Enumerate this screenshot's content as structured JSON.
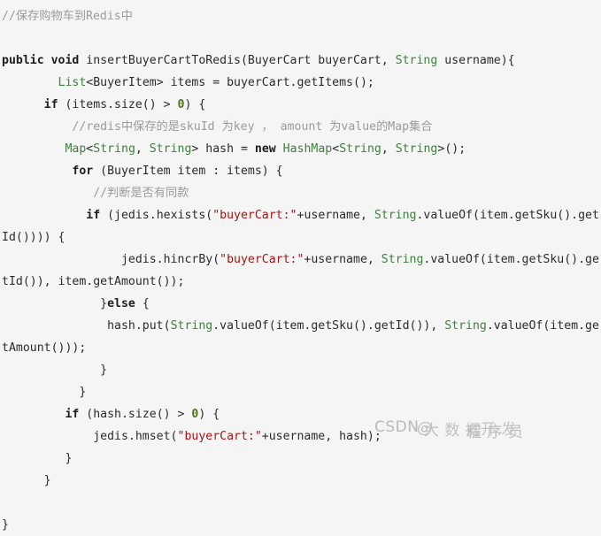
{
  "editor": {
    "language": "java",
    "background_color": "#f5f5f5",
    "default_text_color": "#2b2b2b",
    "colors": {
      "comment": "#9b9b9b",
      "keyword": "#1d1d1d",
      "type": "#3f7f3f",
      "string": "#a31515",
      "number": "#4f6f1f"
    }
  },
  "code": {
    "title_comment": "//保存购物车到Redis中",
    "lines": [
      {
        "id": "line-1",
        "tokens": [
          {
            "t": "comment",
            "v": "//保存购物车到Redis中"
          }
        ]
      },
      {
        "id": "line-2",
        "blank": true,
        "tokens": []
      },
      {
        "id": "line-3",
        "tokens": [
          {
            "t": "keyword",
            "v": "public "
          },
          {
            "t": "keyword",
            "v": "void"
          },
          {
            "t": "plain",
            "v": " insertBuyerCartToRedis(BuyerCart buyerCart, "
          },
          {
            "t": "type",
            "v": "String"
          },
          {
            "t": "plain",
            "v": " username){"
          }
        ]
      },
      {
        "id": "line-4",
        "tokens": [
          {
            "t": "plain",
            "v": "        "
          },
          {
            "t": "type",
            "v": "List"
          },
          {
            "t": "plain",
            "v": "<BuyerItem> items = buyerCart.getItems();"
          }
        ]
      },
      {
        "id": "line-5",
        "tokens": [
          {
            "t": "plain",
            "v": "      "
          },
          {
            "t": "keyword",
            "v": "if"
          },
          {
            "t": "plain",
            "v": " (items.size() > "
          },
          {
            "t": "number",
            "v": "0"
          },
          {
            "t": "plain",
            "v": ") {"
          }
        ]
      },
      {
        "id": "line-6",
        "tokens": [
          {
            "t": "plain",
            "v": "          "
          },
          {
            "t": "comment",
            "v": "//redis中保存的是skuId 为key ， amount 为value的Map集合"
          }
        ]
      },
      {
        "id": "line-7",
        "tokens": [
          {
            "t": "plain",
            "v": "         "
          },
          {
            "t": "type",
            "v": "Map"
          },
          {
            "t": "plain",
            "v": "<"
          },
          {
            "t": "type",
            "v": "String"
          },
          {
            "t": "plain",
            "v": ", "
          },
          {
            "t": "type",
            "v": "String"
          },
          {
            "t": "plain",
            "v": "> hash = "
          },
          {
            "t": "keyword",
            "v": "new"
          },
          {
            "t": "plain",
            "v": " "
          },
          {
            "t": "type",
            "v": "HashMap"
          },
          {
            "t": "plain",
            "v": "<"
          },
          {
            "t": "type",
            "v": "String"
          },
          {
            "t": "plain",
            "v": ", "
          },
          {
            "t": "type",
            "v": "String"
          },
          {
            "t": "plain",
            "v": ">();"
          }
        ]
      },
      {
        "id": "line-8",
        "tokens": [
          {
            "t": "plain",
            "v": "          "
          },
          {
            "t": "keyword",
            "v": "for"
          },
          {
            "t": "plain",
            "v": " (BuyerItem item : items) {"
          }
        ]
      },
      {
        "id": "line-9",
        "tokens": [
          {
            "t": "plain",
            "v": "             "
          },
          {
            "t": "comment",
            "v": "//判断是否有同款"
          }
        ]
      },
      {
        "id": "line-10",
        "tokens": [
          {
            "t": "plain",
            "v": "            "
          },
          {
            "t": "keyword",
            "v": "if"
          },
          {
            "t": "plain",
            "v": " (jedis.hexists("
          },
          {
            "t": "string",
            "v": "\"buyerCart:\""
          },
          {
            "t": "plain",
            "v": "+username, "
          },
          {
            "t": "type",
            "v": "String"
          },
          {
            "t": "plain",
            "v": ".valueOf(item.getSku().getId()))) {"
          }
        ]
      },
      {
        "id": "line-11",
        "tokens": [
          {
            "t": "plain",
            "v": "                 jedis.hincrBy("
          },
          {
            "t": "string",
            "v": "\"buyerCart:\""
          },
          {
            "t": "plain",
            "v": "+username, "
          },
          {
            "t": "type",
            "v": "String"
          },
          {
            "t": "plain",
            "v": ".valueOf(item.getSku().getId()), item.getAmount());"
          }
        ]
      },
      {
        "id": "line-12",
        "tokens": [
          {
            "t": "plain",
            "v": "              }"
          },
          {
            "t": "keyword",
            "v": "else"
          },
          {
            "t": "plain",
            "v": " {"
          }
        ]
      },
      {
        "id": "line-13",
        "tokens": [
          {
            "t": "plain",
            "v": "               hash.put("
          },
          {
            "t": "type",
            "v": "String"
          },
          {
            "t": "plain",
            "v": ".valueOf(item.getSku().getId()), "
          },
          {
            "t": "type",
            "v": "String"
          },
          {
            "t": "plain",
            "v": ".valueOf(item.getAmount()));"
          }
        ]
      },
      {
        "id": "line-14",
        "tokens": [
          {
            "t": "plain",
            "v": "              }"
          }
        ]
      },
      {
        "id": "line-15",
        "tokens": [
          {
            "t": "plain",
            "v": "           }"
          }
        ]
      },
      {
        "id": "line-16",
        "tokens": [
          {
            "t": "plain",
            "v": "         "
          },
          {
            "t": "keyword",
            "v": "if"
          },
          {
            "t": "plain",
            "v": " (hash.size() > "
          },
          {
            "t": "number",
            "v": "0"
          },
          {
            "t": "plain",
            "v": ") {"
          }
        ]
      },
      {
        "id": "line-17",
        "tokens": [
          {
            "t": "plain",
            "v": "             jedis.hmset("
          },
          {
            "t": "string",
            "v": "\"buyerCart:\""
          },
          {
            "t": "plain",
            "v": "+username, hash);"
          }
        ]
      },
      {
        "id": "line-18",
        "tokens": [
          {
            "t": "plain",
            "v": "         }"
          }
        ]
      },
      {
        "id": "line-19",
        "tokens": [
          {
            "t": "plain",
            "v": "      }"
          }
        ]
      },
      {
        "id": "line-20",
        "blank": true,
        "tokens": []
      },
      {
        "id": "line-21",
        "tokens": [
          {
            "t": "plain",
            "v": "}"
          }
        ]
      }
    ]
  },
  "watermark": {
    "brand": "CSDN",
    "handle": "@",
    "overlap_1": "大 数 据",
    "overlap_2": "程 序 员",
    "overlap_3": "开 发",
    "color": "#bdbdbd"
  }
}
